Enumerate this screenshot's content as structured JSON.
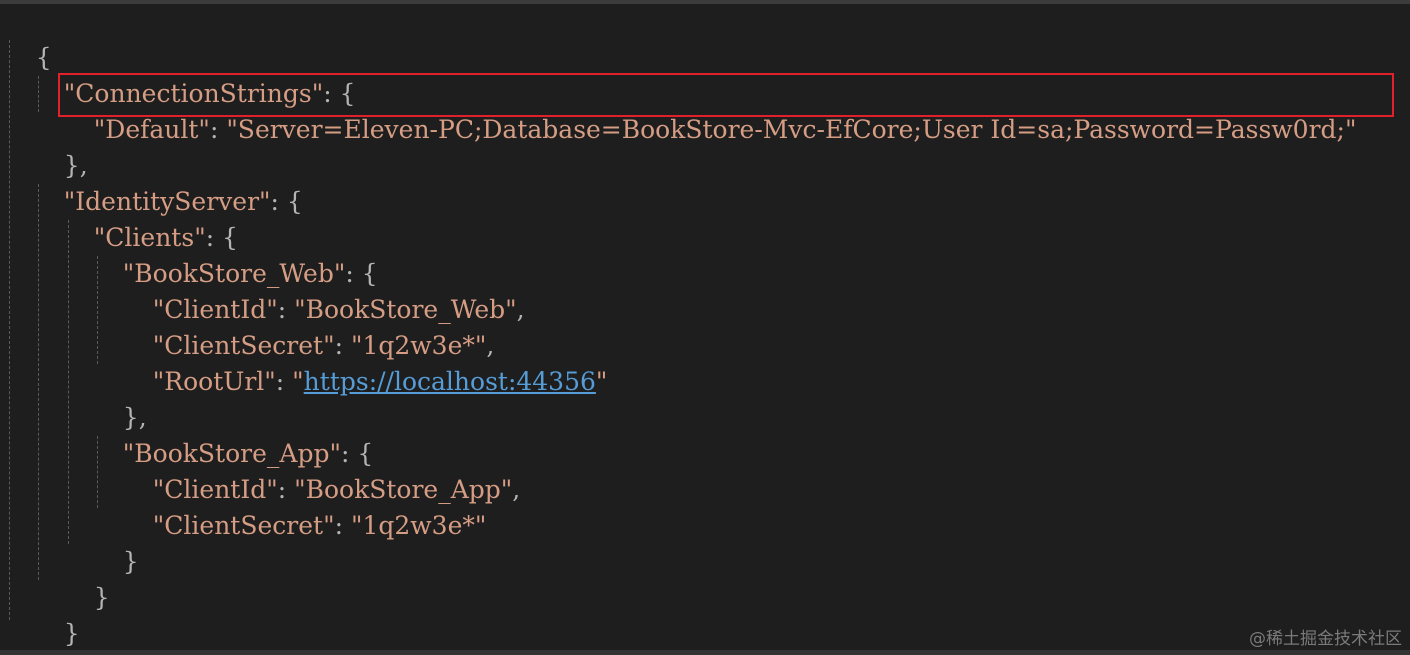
{
  "code": {
    "l1_open": "{",
    "l2_key": "\"ConnectionStrings\"",
    "l2_rest": ": {",
    "l3_key": "\"Default\"",
    "l3_sep": ": ",
    "l3_value": "\"Server=Eleven-PC;Database=BookStore-Mvc-EfCore;User Id=sa;Password=Passw0rd;\"",
    "l4_close": "},",
    "l5_key": "\"IdentityServer\"",
    "l5_rest": ": {",
    "l6_key": "\"Clients\"",
    "l6_rest": ": {",
    "l7_key": "\"BookStore_Web\"",
    "l7_rest": ": {",
    "l8_key": "\"ClientId\"",
    "l8_sep": ": ",
    "l8_value": "\"BookStore_Web\"",
    "l8_end": ",",
    "l9_key": "\"ClientSecret\"",
    "l9_sep": ": ",
    "l9_value": "\"1q2w3e*\"",
    "l9_end": ",",
    "l10_key": "\"RootUrl\"",
    "l10_sep": ": ",
    "l10_q1": "\"",
    "l10_url": "https://localhost:44356",
    "l10_q2": "\"",
    "l11_close": "},",
    "l12_key": "\"BookStore_App\"",
    "l12_rest": ": {",
    "l13_key": "\"ClientId\"",
    "l13_sep": ": ",
    "l13_value": "\"BookStore_App\"",
    "l13_end": ",",
    "l14_key": "\"ClientSecret\"",
    "l14_sep": ": ",
    "l14_value": "\"1q2w3e*\"",
    "l15_close": "}",
    "l16_close": "}",
    "l17_close": "}",
    "l18_close": "}"
  },
  "watermark": "@稀土掘金技术社区",
  "colors": {
    "background": "#1e1e1e",
    "string": "#d69d85",
    "punctuation": "#b4b4b4",
    "link": "#569cd6",
    "highlight_border": "#e0202a"
  }
}
